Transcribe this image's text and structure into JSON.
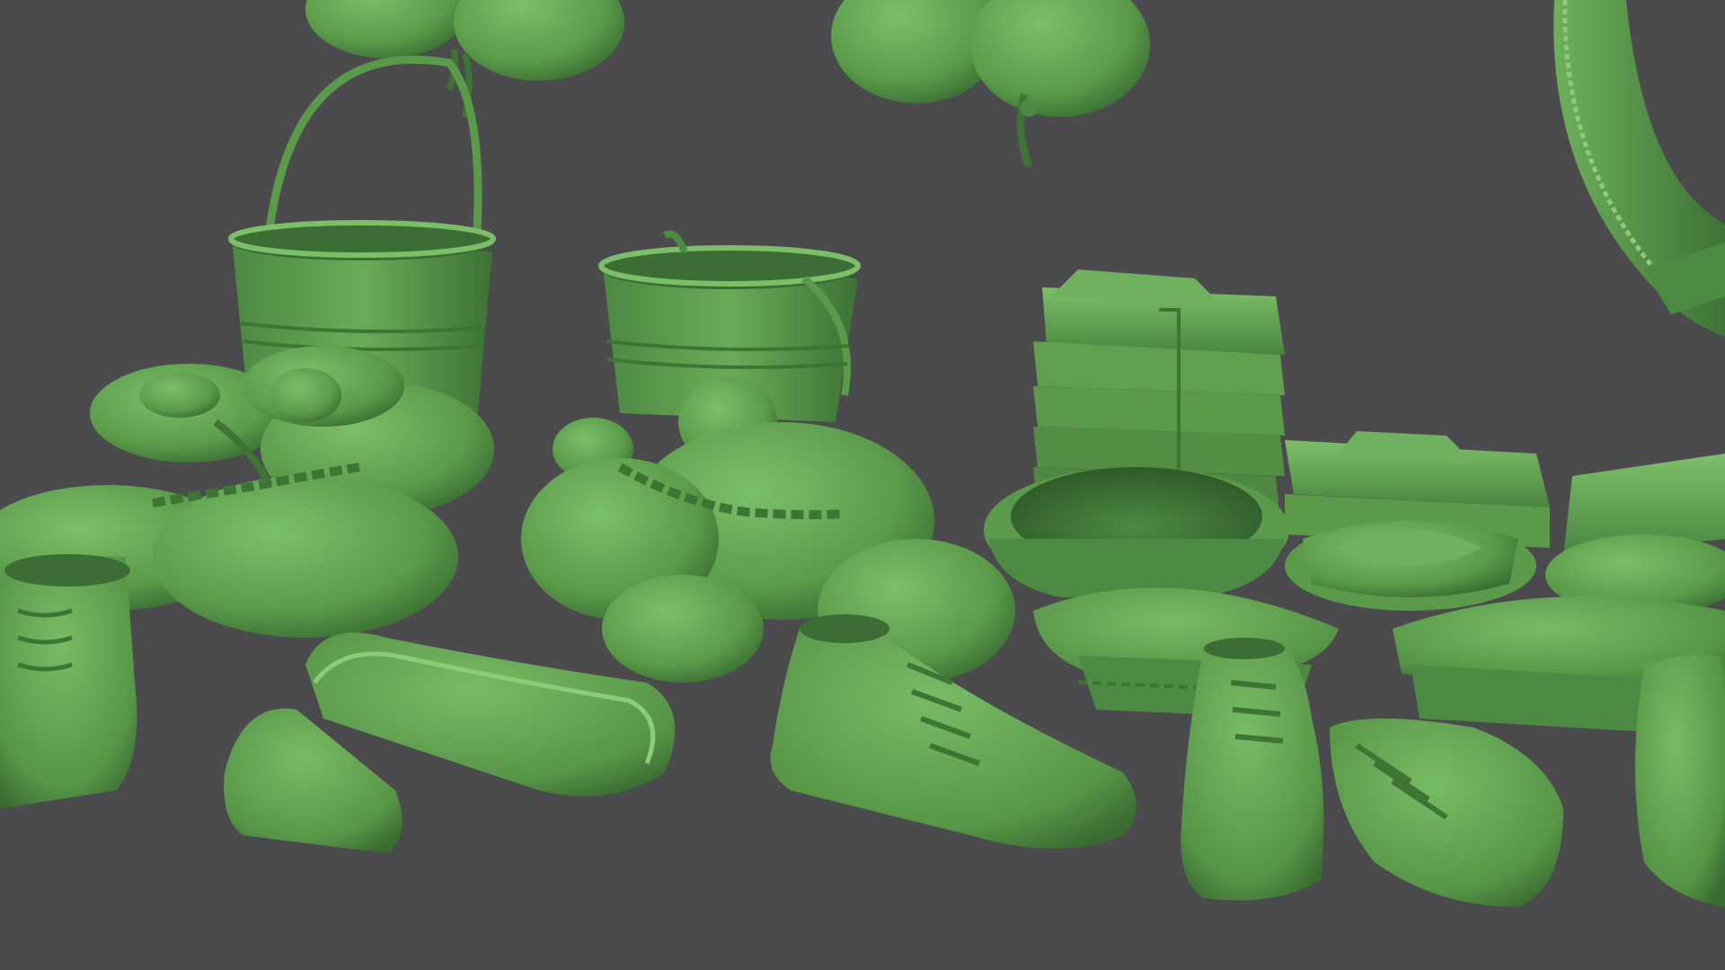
{
  "scene": {
    "background_color": "#4b4b4d",
    "model_color": "#5a9a4a",
    "model_shadow_color": "#3f7534",
    "model_highlight_color": "#7bbf68",
    "objects": [
      "sandbag-icon",
      "bucket-icon",
      "life-ring-icon",
      "folded-shirt-stack-icon",
      "sailor-cap-icon",
      "peaked-cap-icon",
      "boot-icon",
      "chain-icon"
    ]
  }
}
